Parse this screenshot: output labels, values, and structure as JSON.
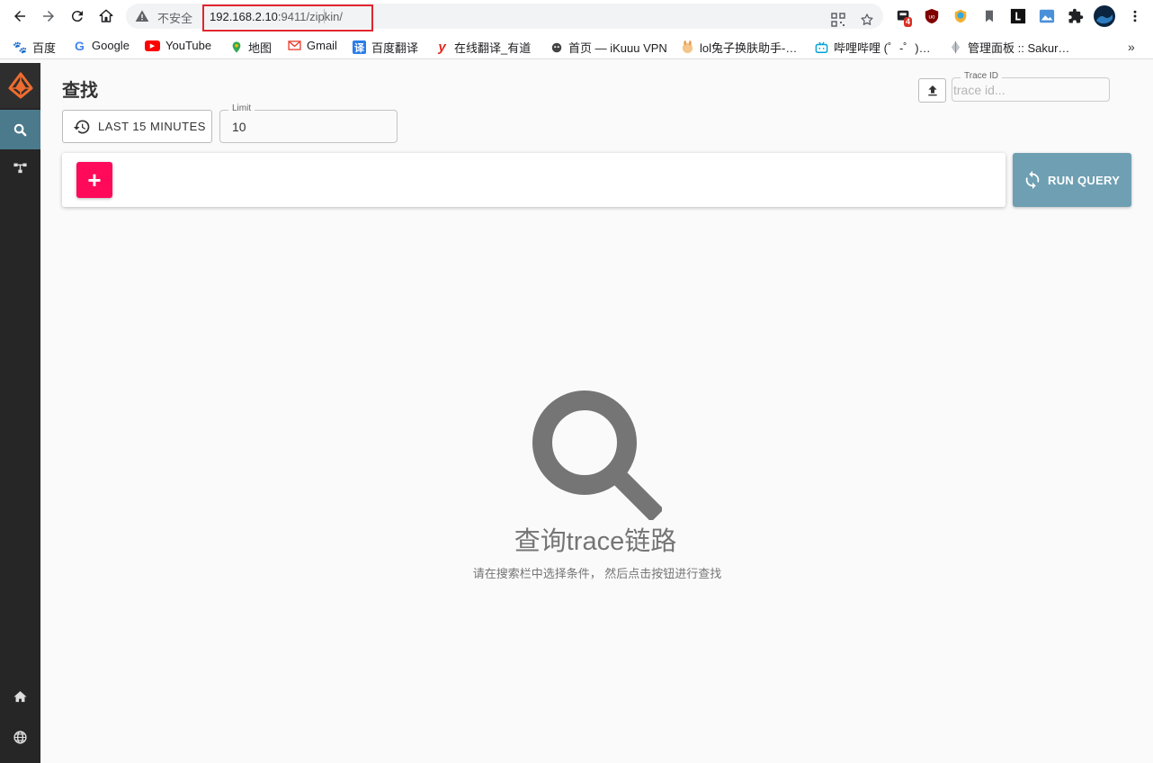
{
  "browser": {
    "insecure_label": "不安全",
    "url_host": "192.168.2.10",
    "url_rest": ":9411/zipkin/",
    "extension_badge": "4"
  },
  "bookmarks": [
    {
      "label": "百度",
      "icon": "baidu-icon",
      "color": "#2932e1"
    },
    {
      "label": "Google",
      "icon": "google-icon",
      "color": "#4285f4"
    },
    {
      "label": "YouTube",
      "icon": "youtube-icon",
      "color": "#ff0000"
    },
    {
      "label": "地图",
      "icon": "maps-icon",
      "color": "#34a853"
    },
    {
      "label": "Gmail",
      "icon": "gmail-icon",
      "color": "#ea4335"
    },
    {
      "label": "百度翻译",
      "icon": "translate-icon",
      "color": "#2b7de9"
    },
    {
      "label": "在线翻译_有道",
      "icon": "youdao-icon",
      "color": "#e4261b"
    },
    {
      "label": "首页 — iKuuu VPN",
      "icon": "ikuuu-icon",
      "color": "#444444"
    },
    {
      "label": "lol兔子换肤助手-…",
      "icon": "rabbit-icon",
      "color": "#e8a050"
    },
    {
      "label": "哔哩哔哩 (゜-゜)…",
      "icon": "bilibili-icon",
      "color": "#00a1d6"
    },
    {
      "label": "管理面板 :: Sakur…",
      "icon": "sakura-icon",
      "color": "#9aa0a6"
    }
  ],
  "sidebar": {
    "items": [
      {
        "name": "search",
        "icon": "search-icon"
      },
      {
        "name": "dependencies",
        "icon": "dependencies-icon"
      },
      {
        "name": "home",
        "icon": "home-icon"
      },
      {
        "name": "language",
        "icon": "globe-icon"
      }
    ]
  },
  "header": {
    "title": "查找"
  },
  "trace_id": {
    "legend": "Trace ID",
    "placeholder": "trace id..."
  },
  "lookback": {
    "label": "LAST 15 MINUTES"
  },
  "limit": {
    "legend": "Limit",
    "value": "10"
  },
  "query": {
    "add_label": "+",
    "run_label": "RUN QUERY"
  },
  "empty_state": {
    "title": "查询trace链路",
    "subtitle": "请在搜索栏中选择条件， 然后点击按钮进行查找"
  },
  "colors": {
    "accent_pink": "#ff0a5a",
    "run_button": "#6e9fb3",
    "sidebar_bg": "#262626",
    "sidebar_active": "#4a7a8c",
    "logo_orange": "#ef6c2e"
  }
}
